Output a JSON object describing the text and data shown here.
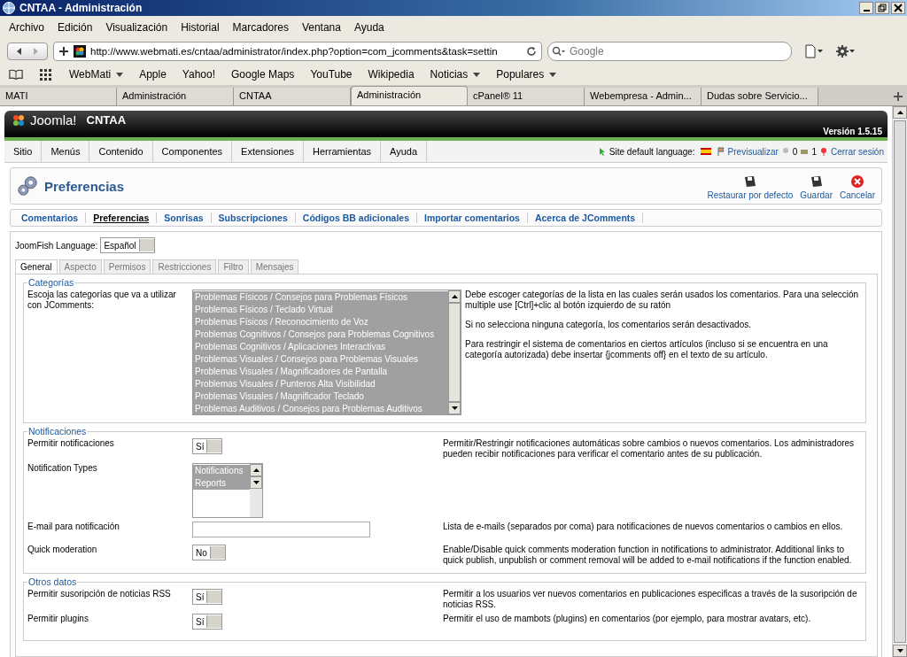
{
  "window": {
    "title": "CNTAA - Administración"
  },
  "menu": [
    "Archivo",
    "Edición",
    "Visualización",
    "Historial",
    "Marcadores",
    "Ventana",
    "Ayuda"
  ],
  "address": {
    "value": "http://www.webmati.es/cntaa/administrator/index.php?option=com_jcomments&task=settin"
  },
  "search": {
    "placeholder": "Google"
  },
  "bookmarks": [
    {
      "label": "WebMati",
      "dropdown": true
    },
    {
      "label": "Apple",
      "dropdown": false
    },
    {
      "label": "Yahoo!",
      "dropdown": false
    },
    {
      "label": "Google Maps",
      "dropdown": false
    },
    {
      "label": "YouTube",
      "dropdown": false
    },
    {
      "label": "Wikipedia",
      "dropdown": false
    },
    {
      "label": "Noticias",
      "dropdown": true
    },
    {
      "label": "Populares",
      "dropdown": true
    }
  ],
  "tabs": [
    {
      "label": "MATI",
      "selected": false
    },
    {
      "label": "Administración",
      "selected": false
    },
    {
      "label": "CNTAA",
      "selected": false
    },
    {
      "label": "Administración",
      "selected": true
    },
    {
      "label": "cPanel® 11",
      "selected": false
    },
    {
      "label": "Webempresa - Admin...",
      "selected": false
    },
    {
      "label": "Dudas sobre Servicio...",
      "selected": false
    }
  ],
  "joomla": {
    "logo": "Joomla!",
    "site": "CNTAA",
    "version": "Versión 1.5.15",
    "menu": [
      "Sitio",
      "Menús",
      "Contenido",
      "Componentes",
      "Extensiones",
      "Herramientas",
      "Ayuda"
    ],
    "status": {
      "language_label": "Site default language:",
      "preview": "Previsualizar",
      "count_1": "0",
      "count_2": "1",
      "logout": "Cerrar sesión"
    },
    "page_title": "Preferencias",
    "toolbar": [
      {
        "label": "Restaurar por defecto",
        "kind": "save"
      },
      {
        "label": "Guardar",
        "kind": "save"
      },
      {
        "label": "Cancelar",
        "kind": "cancel"
      }
    ],
    "submenu": [
      {
        "label": "Comentarios",
        "selected": false
      },
      {
        "label": "Preferencias",
        "selected": true
      },
      {
        "label": "Sonrisas",
        "selected": false
      },
      {
        "label": "Subscripciones",
        "selected": false
      },
      {
        "label": "Códigos BB adicionales",
        "selected": false
      },
      {
        "label": "Importar comentarios",
        "selected": false
      },
      {
        "label": "Acerca de JComments",
        "selected": false
      }
    ],
    "joomfish": {
      "label": "JoomFish Language:",
      "value": "Español"
    },
    "form_tabs": [
      {
        "label": "General",
        "selected": true
      },
      {
        "label": "Aspecto",
        "selected": false
      },
      {
        "label": "Permisos",
        "selected": false
      },
      {
        "label": "Restricciones",
        "selected": false
      },
      {
        "label": "Filtro",
        "selected": false
      },
      {
        "label": "Mensajes",
        "selected": false
      }
    ],
    "fieldsets": [
      {
        "legend": "Categorías",
        "rows": [
          {
            "kind": "listbox",
            "label": "Escoja las categorías que va a utilizar con JComments:",
            "items": [
              {
                "label": "Problemas Físicos / Consejos para Problemas Físicos",
                "selected": true
              },
              {
                "label": "Problemas Físicos / Teclado Virtual",
                "selected": true
              },
              {
                "label": "Problemas Físicos / Reconocimiento de Voz",
                "selected": true
              },
              {
                "label": "Problemas Cognitivos / Consejos para Problemas Cognitivos",
                "selected": true
              },
              {
                "label": "Problemas Cognitivos / Aplicaciones Interactivas",
                "selected": true
              },
              {
                "label": "Problemas Visuales / Consejos para Problemas Visuales",
                "selected": true
              },
              {
                "label": "Problemas Visuales / Magnificadores de Pantalla",
                "selected": true
              },
              {
                "label": "Problemas Visuales / Punteros Alta Visibilidad",
                "selected": true
              },
              {
                "label": "Problemas Visuales / Magnificador Teclado",
                "selected": true
              },
              {
                "label": "Problemas Auditivos / Consejos para Problemas Auditivos",
                "selected": true
              }
            ],
            "description": [
              "Debe escoger categorías de la lista en las cuales serán usados los comentarios. Para una selección multiple use [Ctrl]+clic al botón izquierdo de su ratón",
              "Si no selecciona ninguna categoría, los comentarios serán desactivados.",
              "Para restringir el sistema de comentarios en ciertos artículos (incluso si se encuentra en una categoría autorizada) debe insertar {jcomments off} en el texto de su artículo."
            ]
          }
        ]
      },
      {
        "legend": "Notificaciones",
        "rows": [
          {
            "kind": "toggle",
            "label": "Permitir notificaciones",
            "value": "Sí",
            "description": [
              "Permitir/Restringir notificaciones automáticas sobre cambios o nuevos comentarios. Los administradores pueden recibir notificaciones para verificar el comentario antes de su publicación."
            ]
          },
          {
            "kind": "listbox",
            "label": "Notification Types",
            "items": [
              {
                "label": "Notifications",
                "selected": true
              },
              {
                "label": "Reports",
                "selected": true
              }
            ]
          },
          {
            "kind": "text",
            "label": "E-mail para notificación",
            "description": [
              "Lista de e-mails (separados por coma) para notificaciones de nuevos comentarios o cambios en ellos."
            ]
          },
          {
            "kind": "toggle",
            "label": "Quick moderation",
            "value": "No",
            "description": [
              "Enable/Disable quick comments moderation function in notifications to administrator. Additional links to quick publish, unpublish or comment removal will be added to e-mail notifications if the function enabled."
            ]
          }
        ]
      },
      {
        "legend": "Otros datos",
        "rows": [
          {
            "kind": "toggle",
            "label": "Permitir susoripción de noticias RSS",
            "value": "Sí",
            "description": [
              "Permitir a los usuarios ver nuevos comentarios en publicaciones especificas a través de la susoripción de noticias RSS."
            ]
          },
          {
            "kind": "toggle",
            "label": "Permitir plugins",
            "value": "Sí",
            "description": [
              "Permitir el uso de mambots (plugins) en comentarios (por ejemplo, para mostrar avatars, etc)."
            ]
          }
        ]
      }
    ]
  }
}
